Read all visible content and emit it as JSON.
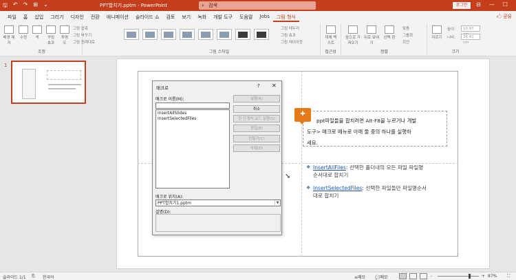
{
  "titlebar": {
    "doc_title": "PPT합치기.pptm  -  PowerPoint",
    "search_placeholder": "검색",
    "login": "로그인",
    "qa_save": "🖫",
    "qa_undo": "↶",
    "qa_redo": "↷",
    "qa_present": "⊞",
    "qa_more": "⌄",
    "win_ribbon": "⊟",
    "win_min": "—",
    "win_max": "☐",
    "win_close": "✕"
  },
  "tabs": [
    "파일",
    "홈",
    "삽입",
    "그리기",
    "디자인",
    "전환",
    "애니메이션",
    "슬라이드 쇼",
    "검토",
    "보기",
    "녹화",
    "개발 도구",
    "도움말",
    "Jobs",
    "그림 형식"
  ],
  "share": "🖒 공유",
  "ribbon": {
    "group_adjust": "조정",
    "group_picture_styles": "그림 스타일",
    "group_accessibility": "접근성",
    "group_arrange": "정렬",
    "group_size": "크기",
    "btn_remove_bg": "배경\n제거",
    "btn_corrections": "수정",
    "btn_color": "색",
    "btn_art_effects": "꾸밈\n효과",
    "btn_transparency": "투명\n도",
    "adjust_compress": "그림 압축",
    "adjust_change": "그림 바꾸기",
    "adjust_reset": "그림 원래대로",
    "style_border": "그림 테두리",
    "style_effects": "그림 효과",
    "style_layout": "그림 레이아웃",
    "btn_alt_text": "대체\n텍스트",
    "btn_bring_forward": "앞으로\n가져오기",
    "btn_send_backward": "뒤로\n보내기",
    "btn_selection_pane": "선택 창",
    "arrange_align": "맞춤",
    "arrange_group": "그룹화",
    "arrange_rotate": "회전",
    "btn_crop": "자르기",
    "size_height_label": "높이:",
    "size_height": "10.97 cm",
    "size_width_label": "너비:",
    "size_width": "26.41 cm"
  },
  "thumbnails": [
    {
      "number": "1"
    }
  ],
  "slide": {
    "note_line1": "ppt파일들을 합치려면 Alt-F8을 누르거나 개발",
    "note_line2": "도구> 매크로 메뉴로 아래 둘 중의 하나를 실행하",
    "note_line3": "세요.",
    "bullets": [
      {
        "link": "InsertAllFiles",
        "text": ": 선택한 폴더내의 모든 파일 파일명",
        "text2": "순서대로 합치기"
      },
      {
        "link": "InsertSelectedFiles",
        "text": ": 선택한 파일들만 파일명순서",
        "text2": "대로 합치기"
      }
    ]
  },
  "dialog": {
    "title": "매크로",
    "help": "?",
    "close": "✕",
    "name_label": "매크로 이름(M):",
    "name_value": "",
    "macros": [
      "InsertAllSlides",
      "InsertSelectedFiles"
    ],
    "buttons": [
      {
        "label": "실행(R)",
        "enabled": false
      },
      {
        "label": "취소",
        "enabled": true
      },
      {
        "label": "한 단계씩 코드 실행(S)",
        "enabled": false
      },
      {
        "label": "편집(E)",
        "enabled": false
      },
      {
        "label": "만들기(C)",
        "enabled": false
      },
      {
        "label": "삭제(D)",
        "enabled": false
      }
    ],
    "location_label": "매크로 위치(A):",
    "location_value": "PPT합치기1.pptm",
    "desc_label": "설명(D):"
  },
  "statusbar": {
    "slide_info": "슬라이드 1/1",
    "language": "한국어",
    "notes": "≡메모",
    "comments": "💬메모",
    "zoom_minus": "-",
    "zoom_plus": "+",
    "zoom": "87%"
  },
  "colors": {
    "accent": "#c43e1c",
    "link": "#1f56a8",
    "note_icon": "#e57a1a"
  }
}
